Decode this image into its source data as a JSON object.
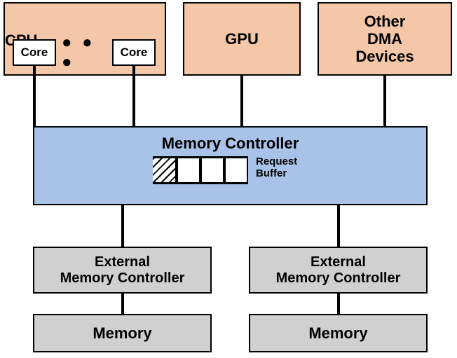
{
  "cpu": {
    "label": "CPU",
    "core1": "Core",
    "core2": "Core",
    "dots": "● ● ●"
  },
  "gpu": {
    "label": "GPU"
  },
  "other": {
    "label": "Other\nDMA\nDevices"
  },
  "memctrl": {
    "label": "Memory Controller",
    "reqbuf_label": "Request\nBuffer"
  },
  "ext": {
    "label": "External\nMemory Controller"
  },
  "mem": {
    "label": "Memory"
  }
}
